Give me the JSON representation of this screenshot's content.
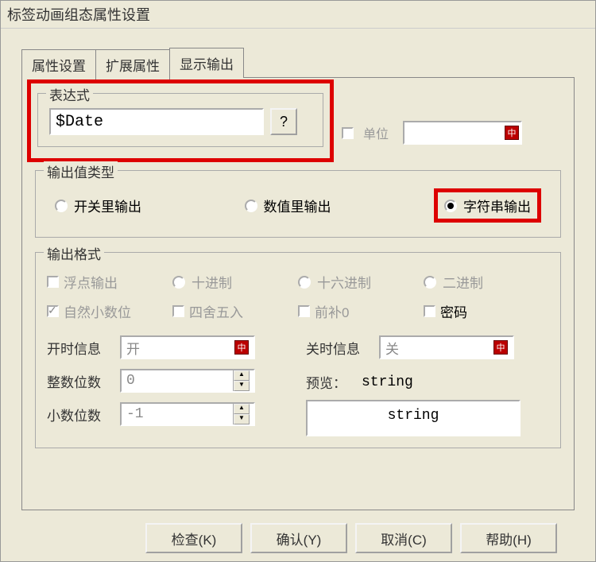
{
  "title": "标签动画组态属性设置",
  "tabs": {
    "t1": "属性设置",
    "t2": "扩展属性",
    "t3": "显示输出"
  },
  "expr": {
    "group": "表达式",
    "value": "$Date",
    "q": "?",
    "unit_chk": "单位"
  },
  "outtype": {
    "group": "输出值类型",
    "r1": "开关里输出",
    "r2": "数值里输出",
    "r3": "字符串输出"
  },
  "fmt": {
    "group": "输出格式",
    "float": "浮点输出",
    "dec": "十进制",
    "hex": "十六进制",
    "bin": "二进制",
    "natural": "自然小数位",
    "round": "四舍五入",
    "pad0": "前补0",
    "pwd": "密码",
    "onmsg": "开时信息",
    "onval": "开",
    "offmsg": "关时信息",
    "offval": "关",
    "intdigits": "整数位数",
    "intval": "0",
    "decdigits": "小数位数",
    "decval": "-1",
    "preview_lbl": "预览：",
    "preview_v": "string",
    "preview_box": "string"
  },
  "buttons": {
    "check": "检查(K)",
    "ok": "确认(Y)",
    "cancel": "取消(C)",
    "help": "帮助(H)"
  }
}
